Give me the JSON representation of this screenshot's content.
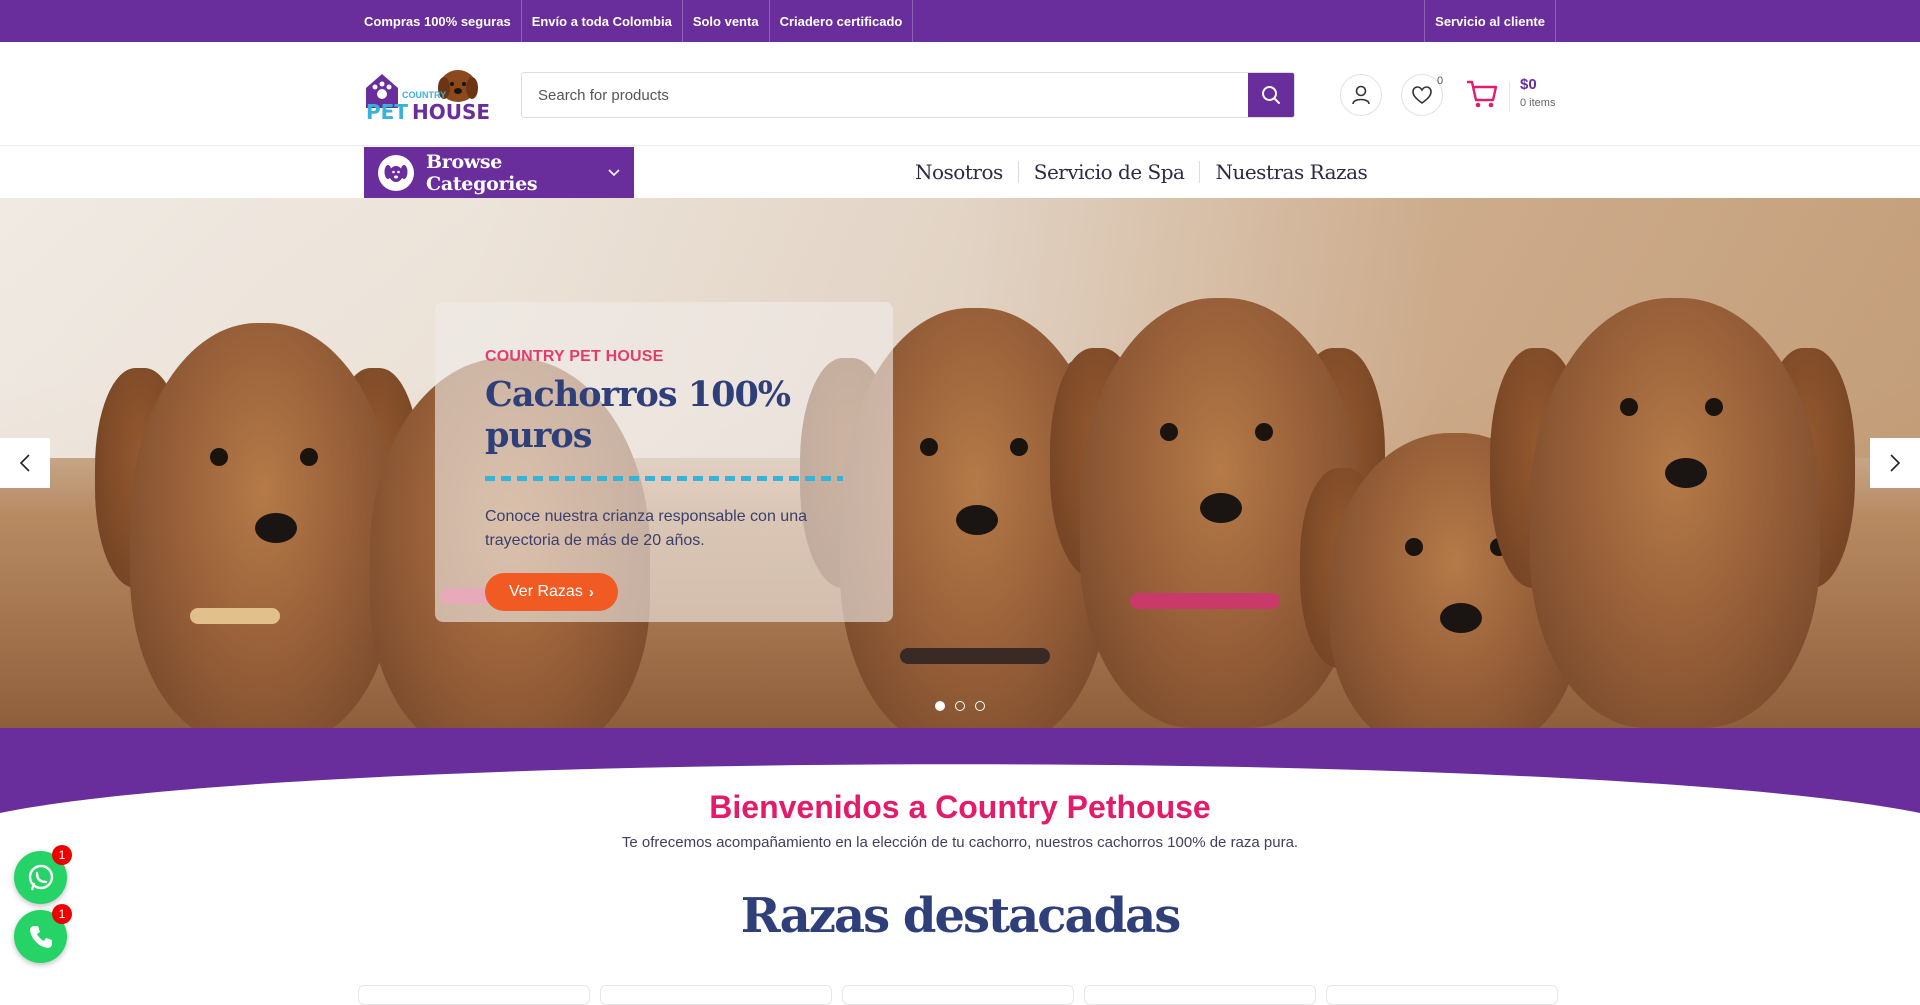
{
  "topbar": {
    "links": [
      "Compras 100% seguras",
      "Envío a toda Colombia",
      "Solo venta",
      "Criadero certificado"
    ],
    "customer_service": "Servicio al cliente"
  },
  "header": {
    "logo_alt": "Country Pet House",
    "search_placeholder": "Search for products",
    "wishlist_count": "0",
    "cart_total": "$0",
    "cart_items": "0 items"
  },
  "nav": {
    "browse_label": "Browse Categories",
    "menu": [
      "Nosotros",
      "Servicio de Spa",
      "Nuestras Razas"
    ]
  },
  "hero": {
    "kicker": "COUNTRY PET HOUSE",
    "title": "Cachorros 100% puros",
    "description": "Conoce nuestra crianza responsable con una trayectoria de más de 20 años.",
    "button_label": "Ver Razas",
    "slides_total": 3,
    "active_slide": 1
  },
  "welcome": {
    "title": "Bienvenidos a Country Pethouse",
    "text": "Te ofrecemos acompañamiento en la elección de tu cachorro, nuestros cachorros 100% de raza pura."
  },
  "featured": {
    "title": "Razas destacadas"
  },
  "floating": {
    "whatsapp_badge": "1",
    "phone_badge": "1"
  },
  "colors": {
    "brand_purple": "#6a2d9c",
    "accent_pink": "#e21b6b",
    "button_orange": "#f15a22",
    "title_navy": "#2f3f7a",
    "whatsapp_green": "#25d366"
  }
}
